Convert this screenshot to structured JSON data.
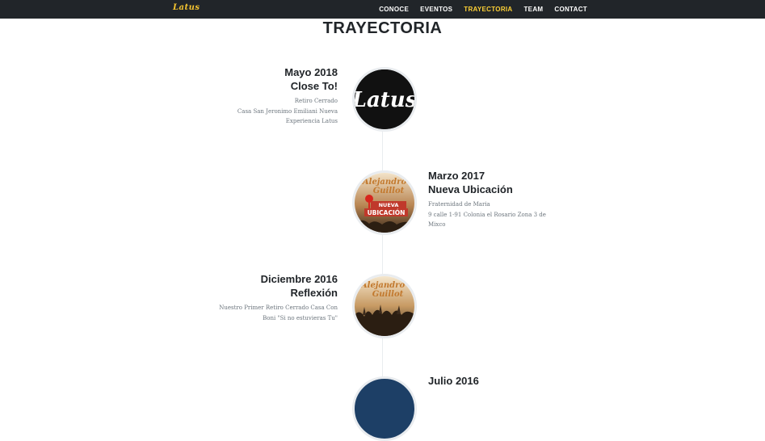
{
  "navbar": {
    "brand": "Latus",
    "links": [
      "CONOCE",
      "EVENTOS",
      "TRAYECTORIA",
      "TEAM",
      "CONTACT"
    ],
    "active": "TRAYECTORIA"
  },
  "section": {
    "title": "TRAYECTORIA"
  },
  "timeline": [
    {
      "date": "Mayo 2018",
      "title": "Close To!",
      "lines": [
        "Retiro Cerrado",
        "Casa San Jeronimo Emiliani Nueva",
        "Experiencia Latus"
      ],
      "image": "latus-logo"
    },
    {
      "date": "Marzo 2017",
      "title": "Nueva Ubicación",
      "lines": [
        "Fraternidad de Maria",
        "9 calle 1-91 Colonia el Rosario Zona 3 de",
        "Mixco"
      ],
      "image": "nueva-ubicacion-poster",
      "poster_text": [
        "Alejandro",
        "Guillot",
        "NUEVA",
        "UBICACIÓN"
      ]
    },
    {
      "date": "Diciembre 2016",
      "title": "Reflexión",
      "lines": [
        "Nuestro Primer Retiro Cerrado Casa Con",
        "Boni \"Si no estuvieras Tu\""
      ],
      "image": "concert-poster",
      "poster_text": [
        "Alejandro",
        "Guillot"
      ]
    },
    {
      "date": "Julio 2016",
      "image": "partial-circle"
    }
  ],
  "colors": {
    "nav_bg": "#212529",
    "accent": "#fed136",
    "brand": "#f4c430"
  }
}
